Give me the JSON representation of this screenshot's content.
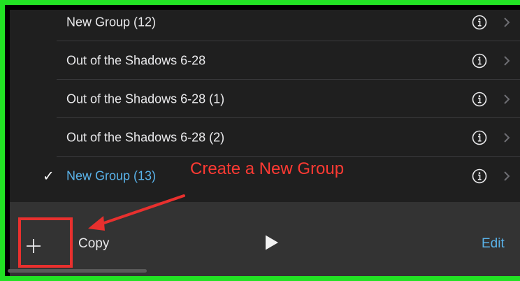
{
  "groups": [
    {
      "label": "New Group (12)",
      "selected": false
    },
    {
      "label": "Out of the Shadows 6-28",
      "selected": false
    },
    {
      "label": "Out of the Shadows 6-28 (1)",
      "selected": false
    },
    {
      "label": "Out of the Shadows 6-28 (2)",
      "selected": false
    },
    {
      "label": "New Group (13)",
      "selected": true
    }
  ],
  "checkmark": "✓",
  "toolbar": {
    "copy_label": "Copy",
    "edit_label": "Edit"
  },
  "annotation": {
    "text": "Create a New Group",
    "color": "#e8302e"
  },
  "colors": {
    "list_bg": "#1f1f1f",
    "toolbar_bg": "#333333",
    "accent": "#5ab3ea",
    "frame": "#22e224"
  }
}
